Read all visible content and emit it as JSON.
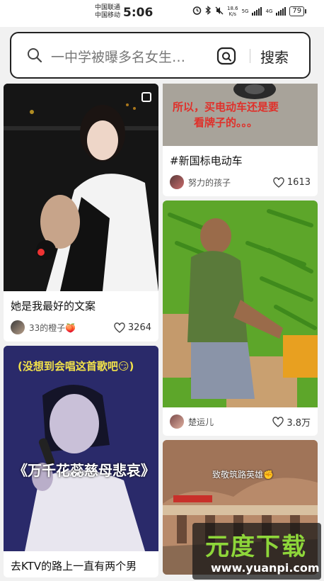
{
  "status_bar": {
    "carrier1": "中国联通",
    "carrier2": "中国移动",
    "time": "5:06",
    "speed_value": "18.6",
    "speed_unit": "K/s",
    "net1": "5G",
    "net2": "4G",
    "battery": "79"
  },
  "search": {
    "query": "一中学被曝多名女生…",
    "button_label": "搜索"
  },
  "feed": {
    "left": [
      {
        "title": "她是我最好的文案",
        "author": "33的橙子🍑",
        "likes": "3264"
      },
      {
        "overlay_top": "(没想到会唱这首歌吧😏)",
        "overlay_main": "《万千花蕊慈母悲哀》",
        "title": "去KTV的路上一直有两个男"
      }
    ],
    "right": [
      {
        "overlay_line1": "所以，买电动车还是要",
        "overlay_line2": "看牌子的。。。",
        "title": "#新国标电动车",
        "author": "努力的孩子",
        "likes": "1613"
      },
      {
        "author": "楚运儿",
        "likes": "3.8万"
      },
      {
        "overlay": "致敬筑路英雄✊"
      }
    ]
  },
  "watermark": {
    "main": "元度下载",
    "url": "www.yuanpi.com"
  },
  "colors": {
    "accent_text": "#222222",
    "overlay_red": "#e0302a",
    "overlay_yellow": "#f2e24a",
    "watermark_green": "#8ed63a"
  }
}
